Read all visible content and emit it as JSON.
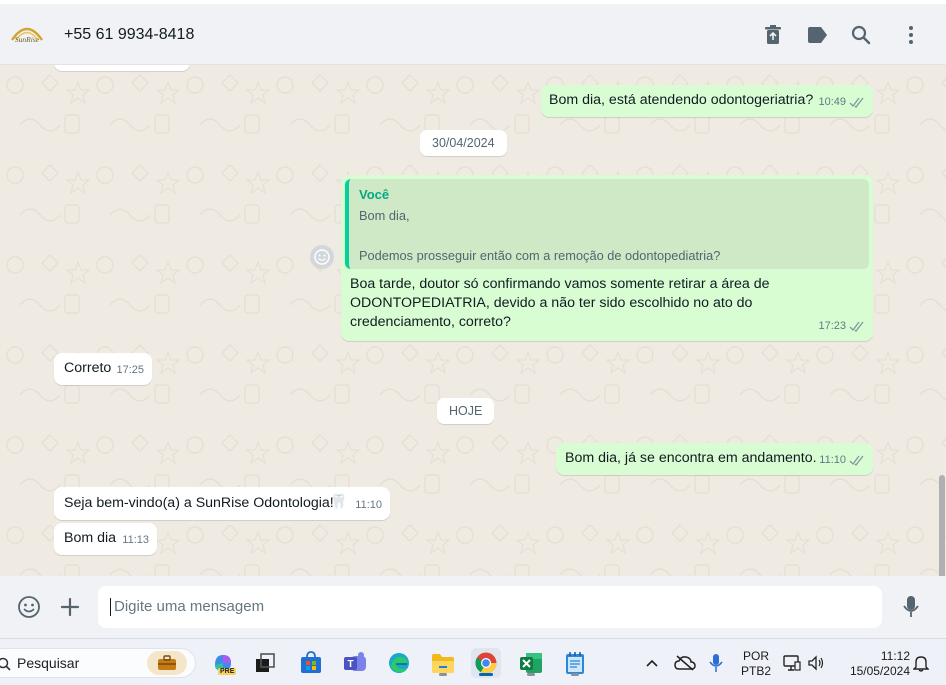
{
  "header": {
    "contact": "+55 61 9934-8418",
    "logo_text": "SunRise",
    "icons": [
      "archive-icon",
      "label-icon",
      "search-icon",
      "menu-icon"
    ]
  },
  "messages": {
    "m1": {
      "text": "Bom dia, está atendendo odontogeriatria?",
      "time": "10:49"
    },
    "date1": "30/04/2024",
    "m2": {
      "quote_author": "Você",
      "quote_text": "Bom dia,\n\nPodemos prosseguir então com a remoção de odontopediatria?",
      "text": "Boa tarde, doutor só confirmando vamos somente retirar a área de ODONTOPEDIATRIA, devido a não ter sido escolhido no ato do credenciamento, correto?",
      "time": "17:23"
    },
    "m3": {
      "text": "Correto",
      "time": "17:25"
    },
    "date2": "HOJE",
    "m4": {
      "text": "Bom dia, já se encontra em andamento.",
      "time": "11:10"
    },
    "m5": {
      "text": "Seja bem-vindo(a) a SunRise Odontologia!",
      "emoji": "🦷",
      "time": "11:10"
    },
    "m6": {
      "text": "Bom dia",
      "time": "11:13"
    }
  },
  "composer": {
    "placeholder": "Digite uma mensagem",
    "icons": [
      "emoji-icon",
      "plus-icon",
      "mic-icon"
    ]
  },
  "taskbar": {
    "search_label": "Pesquisar",
    "apps": [
      "briefcase-icon",
      "copilot-icon",
      "task-view-icon",
      "store-icon",
      "teams-icon",
      "edge-icon",
      "file-explorer-icon",
      "chrome-icon",
      "excel-icon",
      "notepad-icon"
    ],
    "copilot_badge": "PRE",
    "lang_top": "POR",
    "lang_bottom": "PTB2",
    "time": "11:12",
    "date": "15/05/2024"
  },
  "colors": {
    "outgoing": "#d9fdd3",
    "incoming": "#ffffff",
    "background": "#efeae2",
    "accent": "#06cf9c",
    "ticks": "#8696a0"
  }
}
